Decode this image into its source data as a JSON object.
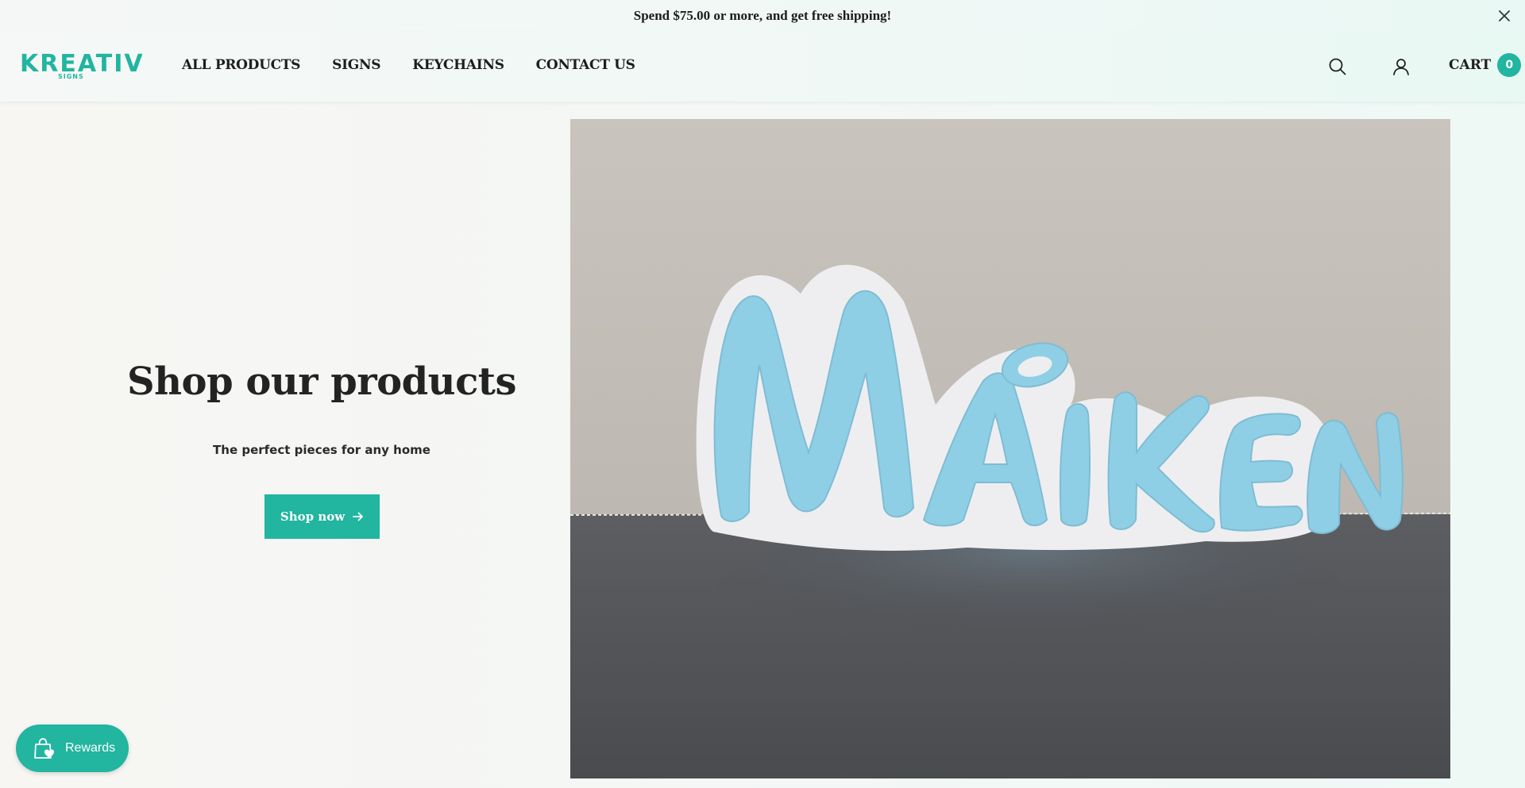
{
  "announcement": {
    "text": "Spend $75.00 or more, and get free shipping!"
  },
  "header": {
    "logo_text": "KREATIV",
    "logo_subtext": "SIGNS",
    "nav": [
      {
        "label": "ALL PRODUCTS"
      },
      {
        "label": "SIGNS"
      },
      {
        "label": "KEYCHAINS"
      },
      {
        "label": "CONTACT US"
      }
    ],
    "cart_label": "CART",
    "cart_count": "0"
  },
  "hero": {
    "title": "Shop our products",
    "subtitle": "The perfect pieces for any home",
    "button_label": "Shop now",
    "image_text": "MAIKEN"
  },
  "rewards": {
    "label": "Rewards"
  },
  "colors": {
    "accent": "#22b5a0",
    "sign_blue": "#8fcfe6"
  },
  "icons": [
    "close-icon",
    "search-icon",
    "user-icon",
    "arrow-right-icon",
    "shopping-bag-heart-icon"
  ]
}
